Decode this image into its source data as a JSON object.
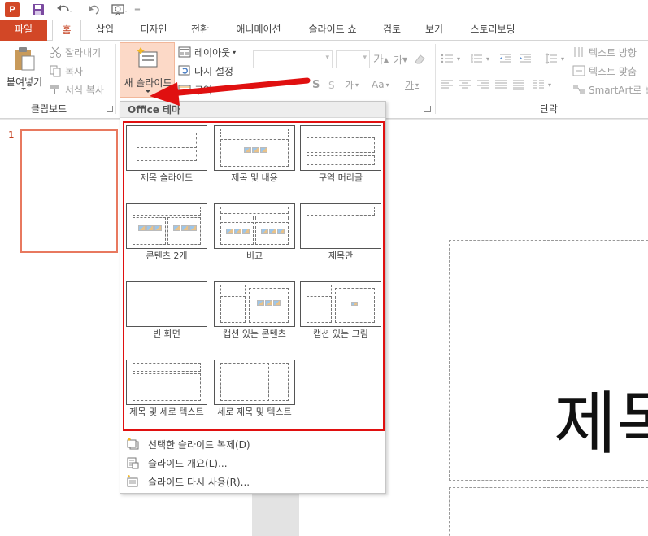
{
  "quick_access": {
    "app_icon_letter": "P",
    "more_glyph": "="
  },
  "tabs": [
    {
      "label": "파일",
      "key": "file"
    },
    {
      "label": "홈",
      "key": "home"
    },
    {
      "label": "삽입",
      "key": "insert"
    },
    {
      "label": "디자인",
      "key": "design"
    },
    {
      "label": "전환",
      "key": "transitions"
    },
    {
      "label": "애니메이션",
      "key": "animations"
    },
    {
      "label": "슬라이드 쇼",
      "key": "slideshow"
    },
    {
      "label": "검토",
      "key": "review"
    },
    {
      "label": "보기",
      "key": "view"
    },
    {
      "label": "스토리보딩",
      "key": "storyboarding"
    }
  ],
  "ribbon": {
    "clipboard": {
      "paste_label": "붙여넣기",
      "cut_label": "잘라내기",
      "copy_label": "복사",
      "format_painter_label": "서식 복사",
      "group_label": "클립보드"
    },
    "slides": {
      "new_slide_label": "새 슬라이드",
      "layout_label": "레이아웃",
      "reset_label": "다시 설정",
      "section_label": "구역"
    },
    "font": {
      "grow_label": "가",
      "shrink_label": "가",
      "strike_label": "S",
      "spacing_label": "가",
      "case_label": "Aa",
      "color_label": "가"
    },
    "paragraph": {
      "group_label": "단락",
      "text_direction_label": "텍스트 방향",
      "align_text_label": "텍스트 맞춤",
      "smartart_label": "SmartArt로 변"
    }
  },
  "thumbnail": {
    "slide_number": "1"
  },
  "slide": {
    "title_fragment": "제목"
  },
  "dropdown": {
    "header": "Office 테마",
    "layouts": [
      {
        "name": "제목 슬라이드"
      },
      {
        "name": "제목 및 내용"
      },
      {
        "name": "구역 머리글"
      },
      {
        "name": "콘텐츠 2개"
      },
      {
        "name": "비교"
      },
      {
        "name": "제목만"
      },
      {
        "name": "빈 화면"
      },
      {
        "name": "캡션 있는 콘텐츠"
      },
      {
        "name": "캡션 있는 그림"
      },
      {
        "name": "제목 및 세로 텍스트"
      },
      {
        "name": "세로 제목 및 텍스트"
      }
    ],
    "menu": [
      {
        "label": "선택한 슬라이드 복제(D)"
      },
      {
        "label": "슬라이드 개요(L)..."
      },
      {
        "label": "슬라이드 다시 사용(R)..."
      }
    ]
  },
  "colors": {
    "accent": "#d24726",
    "highlight_box": "#e01010",
    "arrow": "#e01010",
    "selected_button": "#fcd9c7"
  }
}
